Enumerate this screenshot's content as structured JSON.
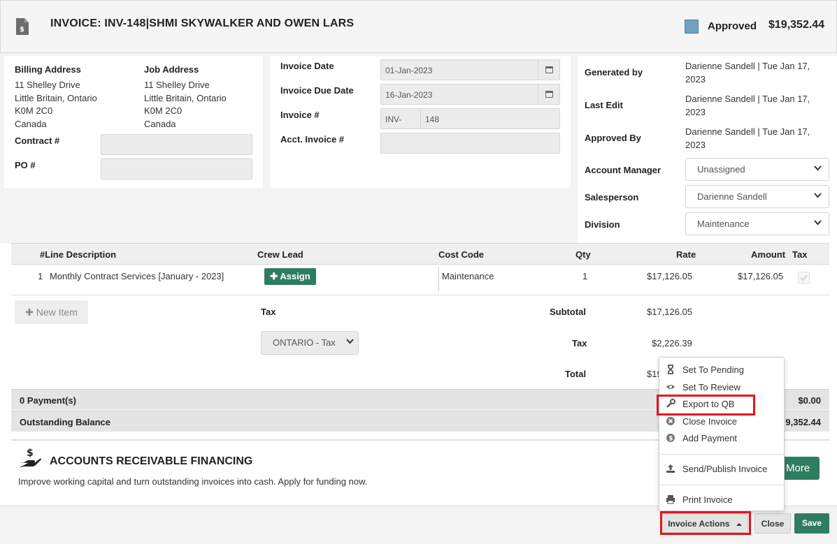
{
  "header": {
    "title": "INVOICE: INV-148|SHMI SKYWALKER AND OWEN LARS",
    "status_label": "Approved",
    "status_color": "#6fa3bd",
    "total": "$19,352.44",
    "icon": "invoice-document-icon"
  },
  "addresses": {
    "billing_label": "Billing Address",
    "billing_lines": [
      "11 Shelley Drive",
      "Little Britain, Ontario",
      "K0M 2C0",
      "Canada"
    ],
    "job_label": "Job Address",
    "job_lines": [
      "11 Shelley Drive",
      "Little Britain, Ontario",
      "K0M 2C0",
      "Canada"
    ],
    "contract_label": "Contract #",
    "contract_value": "",
    "po_label": "PO #",
    "po_value": ""
  },
  "dates": {
    "invoice_date_label": "Invoice Date",
    "invoice_date": "01-Jan-2023",
    "due_date_label": "Invoice Due Date",
    "due_date": "16-Jan-2023",
    "invoice_num_label": "Invoice #",
    "invoice_prefix": "INV-",
    "invoice_num": "148",
    "acct_invoice_label": "Acct. Invoice #",
    "acct_invoice": ""
  },
  "meta": {
    "generated_by_label": "Generated by",
    "generated_by_line1": "Darienne Sandell | Tue Jan 17,",
    "generated_by_line2": "2023",
    "last_edit_label": "Last Edit",
    "last_edit_line1": "Darienne Sandell | Tue Jan 17,",
    "last_edit_line2": "2023",
    "approved_by_label": "Approved By",
    "approved_by_line1": "Darienne Sandell | Tue Jan 17,",
    "approved_by_line2": "2023",
    "account_manager_label": "Account Manager",
    "account_manager": "Unassigned",
    "salesperson_label": "Salesperson",
    "salesperson": "Darienne Sandell",
    "division_label": "Division",
    "division": "Maintenance"
  },
  "table": {
    "headers": {
      "line_description": "#Line Description",
      "crew_lead": "Crew Lead",
      "cost_code": "Cost Code",
      "qty": "Qty",
      "rate": "Rate",
      "amount": "Amount",
      "tax": "Tax"
    },
    "rows": [
      {
        "num": "1",
        "description": "Monthly Contract Services [January - 2023]",
        "crew_lead_button": "Assign",
        "cost_code": "Maintenance",
        "qty": "1",
        "rate": "$17,126.05",
        "amount": "$17,126.05",
        "tax_checked": true
      }
    ]
  },
  "summary": {
    "new_item_label": "New Item",
    "tax_label": "Tax",
    "tax_select": "ONTARIO - Tax",
    "subtotal_label": "Subtotal",
    "subtotal": "$17,126.05",
    "tax_amount_label": "Tax",
    "tax_amount": "$2,226.39",
    "total_label": "Total",
    "total_partial": "$19",
    "payments_label": "0 Payment(s)",
    "payments_amount": "$0.00",
    "outstanding_label": "Outstanding Balance",
    "outstanding_partial": "9,352.44"
  },
  "financing": {
    "title": "ACCOUNTS RECEIVABLE FINANCING",
    "description": "Improve working capital and turn outstanding invoices into cash. Apply for funding now.",
    "button": "More",
    "icon": "hand-dollar-icon"
  },
  "menu": {
    "items": [
      {
        "label": "Set To Pending",
        "icon": "hourglass-icon"
      },
      {
        "label": "Set To Review",
        "icon": "eye-icon"
      },
      {
        "label": "Export to QB",
        "icon": "wrench-icon"
      },
      {
        "label": "Close Invoice",
        "icon": "close-circle-icon"
      },
      {
        "label": "Add Payment",
        "icon": "dollar-circle-icon"
      },
      {
        "label": "Send/Publish Invoice",
        "icon": "upload-icon"
      },
      {
        "label": "Print Invoice",
        "icon": "printer-icon"
      }
    ]
  },
  "footer": {
    "invoice_actions": "Invoice Actions",
    "close": "Close",
    "save": "Save"
  },
  "colors": {
    "primary_green": "#2f7d61",
    "highlight_red": "#e8141b",
    "status_blue": "#6fa3bd"
  }
}
